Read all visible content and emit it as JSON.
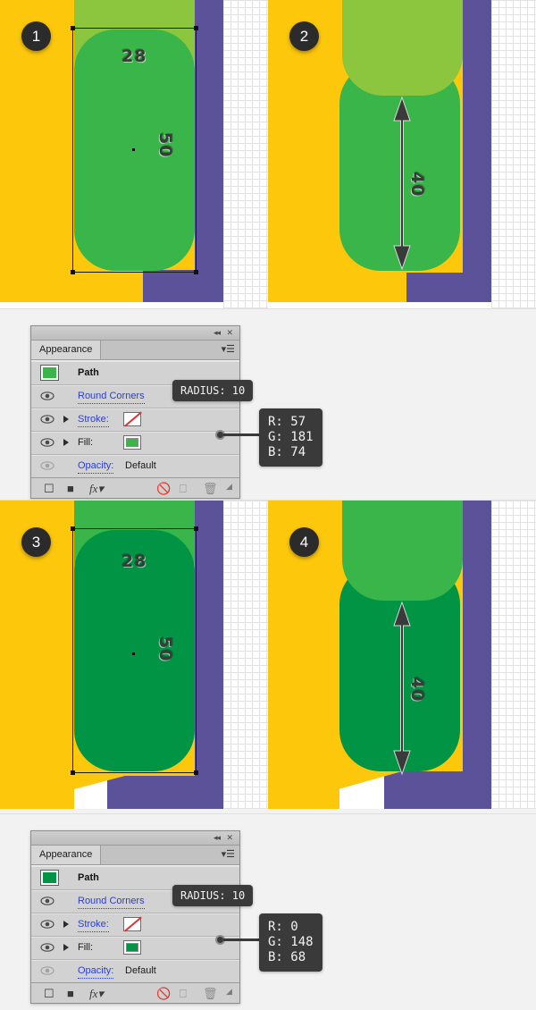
{
  "steps": [
    {
      "number": "1",
      "labels": {
        "width": "28",
        "height": "50"
      }
    },
    {
      "number": "2",
      "labels": {
        "measure": "40"
      }
    },
    {
      "number": "3",
      "labels": {
        "width": "28",
        "height": "50"
      }
    },
    {
      "number": "4",
      "labels": {
        "measure": "40"
      }
    }
  ],
  "colors": {
    "yellow": "#fdc70c",
    "purple": "#5b529a",
    "green_light_1": "#8cc63f",
    "green_mid_1": "#39b54a",
    "green_light_2": "#39b54a",
    "green_mid_2": "#009444",
    "badge_bg": "#2b2b2b",
    "tooltip_bg": "#3a3a3a",
    "link_blue": "#2b3fd0"
  },
  "panels": [
    {
      "title": "Appearance",
      "tooltip_radius": "RADIUS: 10",
      "tooltip_rgb": "R: 57\nG: 181\nB: 74",
      "rgb": {
        "r": "R: 57",
        "g": "G: 181",
        "b": "B: 74"
      },
      "path_label": "Path",
      "path_swatch": "#39b54a",
      "rows": [
        {
          "label": "Round Corners",
          "type": "link",
          "eye": true,
          "triangle": false
        },
        {
          "label": "Stroke:",
          "type": "link",
          "eye": true,
          "triangle": true,
          "swatch": "none"
        },
        {
          "label": "Fill:",
          "type": "plain",
          "eye": true,
          "triangle": true,
          "swatch": "#39b54a"
        },
        {
          "label": "Opacity:",
          "value": "Default",
          "type": "link",
          "eye": false,
          "triangle": false
        }
      ],
      "footer_icons": [
        "new-fill-icon",
        "new-stroke-icon",
        "fx-icon",
        "clear-appearance-icon",
        "duplicate-item-icon",
        "delete-item-icon",
        "resize-grip-icon"
      ],
      "titlebar_icons": [
        "collapse-icon",
        "close-icon",
        "panel-menu-icon"
      ]
    },
    {
      "title": "Appearance",
      "tooltip_radius": "RADIUS: 10",
      "tooltip_rgb": "R: 0\nG: 148\nB: 68",
      "rgb": {
        "r": "R: 0",
        "g": "G: 148",
        "b": "B: 68"
      },
      "path_label": "Path",
      "path_swatch": "#009444",
      "rows": [
        {
          "label": "Round Corners",
          "type": "link",
          "eye": true,
          "triangle": false
        },
        {
          "label": "Stroke:",
          "type": "link",
          "eye": true,
          "triangle": true,
          "swatch": "none"
        },
        {
          "label": "Fill:",
          "type": "plain",
          "eye": true,
          "triangle": true,
          "swatch": "#009444"
        },
        {
          "label": "Opacity:",
          "value": "Default",
          "type": "link",
          "eye": false,
          "triangle": false
        }
      ],
      "footer_icons": [
        "new-fill-icon",
        "new-stroke-icon",
        "fx-icon",
        "clear-appearance-icon",
        "duplicate-item-icon",
        "delete-item-icon",
        "resize-grip-icon"
      ],
      "titlebar_icons": [
        "collapse-icon",
        "close-icon",
        "panel-menu-icon"
      ]
    }
  ]
}
